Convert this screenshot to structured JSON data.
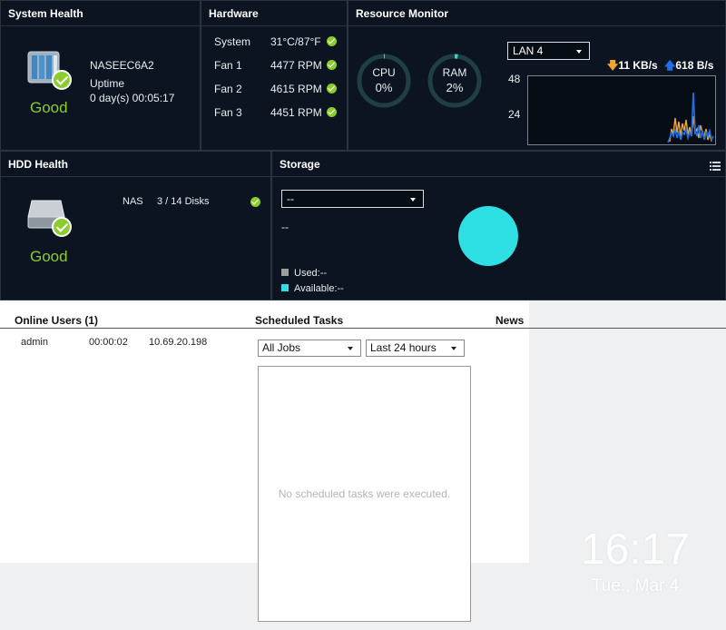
{
  "system_health": {
    "title": "System Health",
    "status": "Good",
    "device_name": "NASEEC6A2",
    "uptime_label": "Uptime",
    "uptime_value": "0 day(s) 00:05:17"
  },
  "hardware": {
    "title": "Hardware",
    "rows": [
      {
        "label": "System",
        "value": "31°C/87°F"
      },
      {
        "label": "Fan 1",
        "value": "4477 RPM"
      },
      {
        "label": "Fan 2",
        "value": "4615 RPM"
      },
      {
        "label": "Fan 3",
        "value": "4451 RPM"
      }
    ]
  },
  "resource_monitor": {
    "title": "Resource Monitor",
    "cpu": {
      "label": "CPU",
      "value": "0%",
      "percent": 0
    },
    "ram": {
      "label": "RAM",
      "value": "2%",
      "percent": 2
    },
    "network_select": "LAN 4",
    "download_rate": "11 KB/s",
    "upload_rate": "618 B/s",
    "y_ticks": [
      "48",
      "24"
    ],
    "colors": {
      "download": "#f0a531",
      "upload": "#1f6fe8",
      "gauge_track": "#1f3f45",
      "gauge_fill": "#2ed6cf"
    }
  },
  "hdd_health": {
    "title": "HDD Health",
    "status": "Good",
    "nas_label": "NAS",
    "disks": "3 / 14 Disks"
  },
  "storage": {
    "title": "Storage",
    "volume_select": "--",
    "volume_value": "--",
    "used_label": "Used:--",
    "available_label": "Available:--",
    "colors": {
      "used": "#9e9e9e",
      "available": "#2ee0e3"
    }
  },
  "online_users": {
    "title": "Online Users (1)",
    "users": [
      {
        "name": "admin",
        "time": "00:00:02",
        "ip": "10.69.20.198"
      }
    ]
  },
  "scheduled_tasks": {
    "title": "Scheduled Tasks",
    "job_filter": "All Jobs",
    "time_filter": "Last 24 hours",
    "empty_message": "No scheduled tasks were executed."
  },
  "news": {
    "title": "News"
  },
  "clock": {
    "time": "16:17",
    "date": "Tue., Mar 4"
  }
}
